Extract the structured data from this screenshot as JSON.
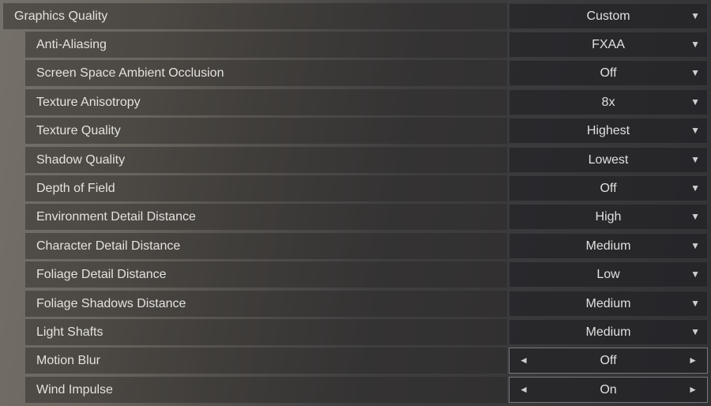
{
  "settings": [
    {
      "label": "Graphics Quality",
      "value": "Custom",
      "control": "dropdown"
    },
    {
      "label": "Anti-Aliasing",
      "value": "FXAA",
      "control": "dropdown"
    },
    {
      "label": "Screen Space Ambient Occlusion",
      "value": "Off",
      "control": "dropdown"
    },
    {
      "label": "Texture Anisotropy",
      "value": "8x",
      "control": "dropdown"
    },
    {
      "label": "Texture Quality",
      "value": "Highest",
      "control": "dropdown"
    },
    {
      "label": "Shadow Quality",
      "value": "Lowest",
      "control": "dropdown"
    },
    {
      "label": "Depth of Field",
      "value": "Off",
      "control": "dropdown"
    },
    {
      "label": "Environment Detail Distance",
      "value": "High",
      "control": "dropdown"
    },
    {
      "label": "Character Detail Distance",
      "value": "Medium",
      "control": "dropdown"
    },
    {
      "label": "Foliage Detail Distance",
      "value": "Low",
      "control": "dropdown"
    },
    {
      "label": "Foliage Shadows Distance",
      "value": "Medium",
      "control": "dropdown"
    },
    {
      "label": "Light Shafts",
      "value": "Medium",
      "control": "dropdown"
    },
    {
      "label": "Motion Blur",
      "value": "Off",
      "control": "cycle"
    },
    {
      "label": "Wind Impulse",
      "value": "On",
      "control": "cycle"
    }
  ],
  "icons": {
    "dropdown": "▼",
    "left": "◄",
    "right": "►"
  }
}
